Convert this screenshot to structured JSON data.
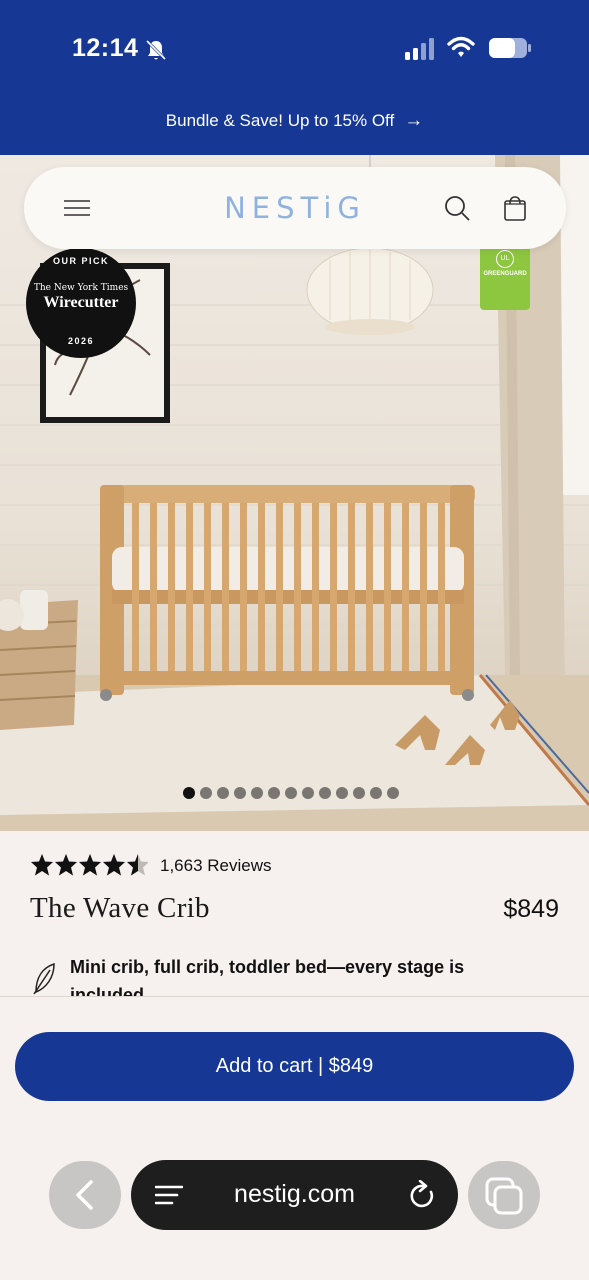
{
  "status_bar": {
    "time": "12:14"
  },
  "promo": {
    "text": "Bundle & Save! Up to 15% Off",
    "arrow": "→"
  },
  "nav": {
    "logo": "NESTiG"
  },
  "badges": {
    "wirecutter": {
      "top": "OUR PICK",
      "nyt": "The New York Times",
      "name": "Wirecutter",
      "year": "2026"
    },
    "greenguard": {
      "ul": "UL",
      "label": "GREENGUARD"
    }
  },
  "carousel": {
    "total": 13,
    "active_index": 0
  },
  "product": {
    "rating": 4.5,
    "rating_max": 5,
    "reviews": "1,663 Reviews",
    "title": "The Wave Crib",
    "price": "$849",
    "feature": "Mini crib, full crib, toddler bed—every stage is included"
  },
  "cta": {
    "label": "Add to cart | $849"
  },
  "browser": {
    "url": "nestig.com"
  },
  "colors": {
    "brand_blue": "#163894",
    "logo_blue": "#8fb3de",
    "greenguard_green": "#8dc63f"
  }
}
